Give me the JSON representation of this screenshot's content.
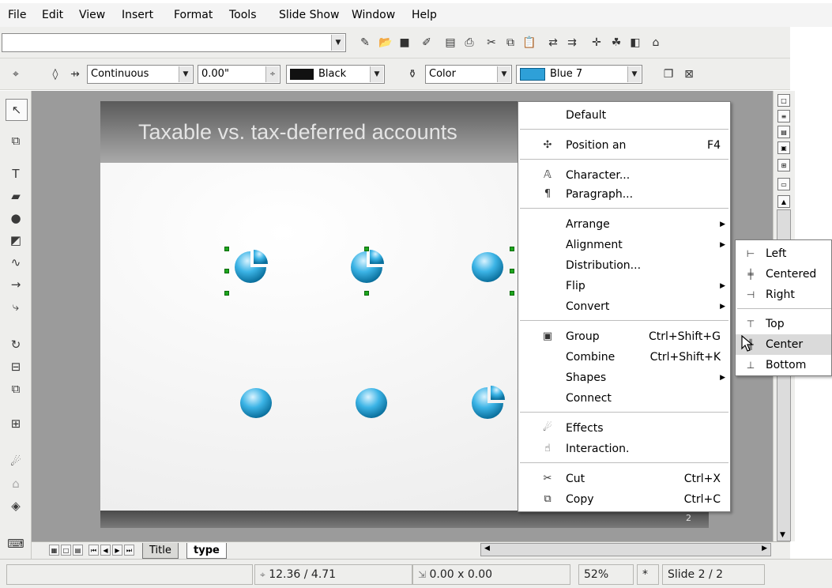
{
  "menubar": {
    "items": [
      "File",
      "Edit",
      "View",
      "Insert",
      "Format",
      "Tools",
      "Slide Show",
      "Window",
      "Help"
    ]
  },
  "line_toolbar": {
    "line_style": "Continuous",
    "line_width": "0.00\"",
    "line_color": "Black",
    "area_style": "Color",
    "area_color": "Blue 7"
  },
  "slide": {
    "title": "Taxable vs. tax-deferred accounts",
    "number": "2"
  },
  "context_menu": {
    "items": [
      {
        "label": "Default",
        "shortcut": "",
        "arrow": false,
        "icon": ""
      },
      {
        "label": "Position an",
        "shortcut": "F4",
        "arrow": false,
        "icon": "position-icon"
      },
      {
        "label": "Character...",
        "shortcut": "",
        "arrow": false,
        "icon": "character-icon"
      },
      {
        "label": "Paragraph...",
        "shortcut": "",
        "arrow": false,
        "icon": "paragraph-icon"
      },
      {
        "label": "Arrange",
        "shortcut": "",
        "arrow": true,
        "icon": ""
      },
      {
        "label": "Alignment",
        "shortcut": "",
        "arrow": true,
        "icon": ""
      },
      {
        "label": "Distribution...",
        "shortcut": "",
        "arrow": false,
        "icon": ""
      },
      {
        "label": "Flip",
        "shortcut": "",
        "arrow": true,
        "icon": ""
      },
      {
        "label": "Convert",
        "shortcut": "",
        "arrow": true,
        "icon": ""
      },
      {
        "label": "Group",
        "shortcut": "Ctrl+Shift+G",
        "arrow": false,
        "icon": "group-icon"
      },
      {
        "label": "Combine",
        "shortcut": "Ctrl+Shift+K",
        "arrow": false,
        "icon": ""
      },
      {
        "label": "Shapes",
        "shortcut": "",
        "arrow": true,
        "icon": ""
      },
      {
        "label": "Connect",
        "shortcut": "",
        "arrow": false,
        "icon": ""
      },
      {
        "label": "Effects",
        "shortcut": "",
        "arrow": false,
        "icon": "effects-icon"
      },
      {
        "label": "Interaction.",
        "shortcut": "",
        "arrow": false,
        "icon": "interaction-icon"
      },
      {
        "label": "Cut",
        "shortcut": "Ctrl+X",
        "arrow": false,
        "icon": "scissors-icon"
      },
      {
        "label": "Copy",
        "shortcut": "Ctrl+C",
        "arrow": false,
        "icon": "copy-icon"
      }
    ]
  },
  "alignment_submenu": {
    "items": [
      {
        "label": "Left",
        "icon": "align-left-icon",
        "active": false
      },
      {
        "label": "Centered",
        "icon": "align-centered-icon",
        "active": false
      },
      {
        "label": "Right",
        "icon": "align-right-icon",
        "active": false
      },
      {
        "label": "Top",
        "icon": "align-top-icon",
        "active": false
      },
      {
        "label": "Center",
        "icon": "align-center-icon",
        "active": true
      },
      {
        "label": "Bottom",
        "icon": "align-bottom-icon",
        "active": false
      }
    ]
  },
  "slide_tabs": [
    "Title",
    "type"
  ],
  "statusbar": {
    "position": "12.36 / 4.71",
    "size": "0.00 x 0.00",
    "zoom": "52%",
    "modified": "*",
    "slide": "Slide 2 / 2"
  }
}
